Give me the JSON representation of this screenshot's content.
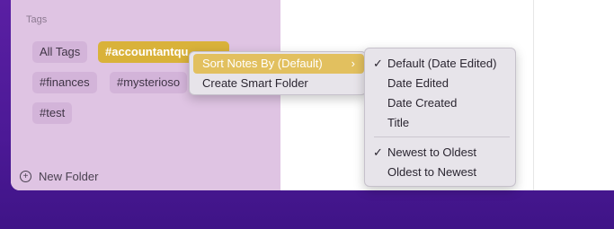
{
  "sidebar": {
    "section_title": "Tags",
    "tags": [
      "All Tags",
      "#accountantqu",
      "#finances",
      "#mysterioso",
      "#test"
    ],
    "new_folder_label": "New Folder"
  },
  "context_menu": {
    "items": [
      "Sort Notes By (Default)",
      "Create Smart Folder"
    ],
    "chevron": "›"
  },
  "submenu": {
    "items": [
      "Default (Date Edited)",
      "Date Edited",
      "Date Created",
      "Title",
      "Newest to Oldest",
      "Oldest to Newest"
    ],
    "checkmark": "✓",
    "checked": [
      "Default (Date Edited)",
      "Newest to Oldest"
    ]
  },
  "colors": {
    "sidebar_bg": "#dfc4e3",
    "selected_tag": "#d9b23a",
    "menu_highlight": "#e2c05f",
    "desktop": "#4c1996"
  },
  "icons": {
    "new_folder": "plus-circle-icon",
    "submenu_arrow": "chevron-right-icon",
    "check": "checkmark-icon"
  }
}
